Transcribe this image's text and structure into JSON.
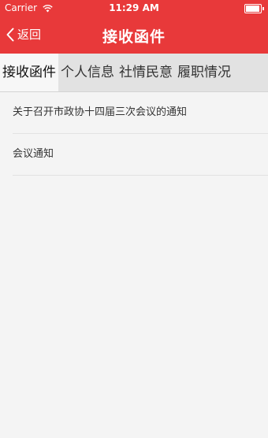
{
  "status_bar": {
    "carrier": "Carrier",
    "time": "11:29 AM",
    "battery_level": 0.95
  },
  "nav": {
    "back_label": "返回",
    "title": "接收函件"
  },
  "tabs": [
    {
      "label": "接收函件",
      "active": true
    },
    {
      "label": "个人信息",
      "active": false
    },
    {
      "label": "社情民意",
      "active": false
    },
    {
      "label": "履职情况",
      "active": false
    }
  ],
  "list": [
    {
      "title": "关于召开市政协十四届三次会议的通知"
    },
    {
      "title": "会议通知"
    }
  ],
  "colors": {
    "header_bg": "#e8393a",
    "tab_bar_bg": "#e2e2e2",
    "active_tab_bg": "#f7f7f7",
    "page_bg": "#f4f4f4"
  }
}
